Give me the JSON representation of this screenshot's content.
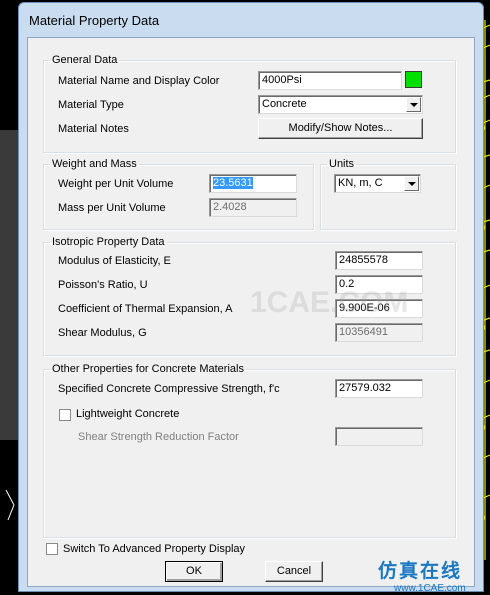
{
  "dialog": {
    "title": "Material Property Data"
  },
  "general": {
    "legend": "General Data",
    "name_label": "Material Name and Display Color",
    "name_value": "4000Psi",
    "display_color": "#00e000",
    "type_label": "Material Type",
    "type_value": "Concrete",
    "notes_label": "Material Notes",
    "notes_button": "Modify/Show Notes..."
  },
  "weight": {
    "legend": "Weight and Mass",
    "weight_label": "Weight per Unit Volume",
    "weight_value": "23.5631",
    "mass_label": "Mass per Unit Volume",
    "mass_value": "2.4028"
  },
  "units": {
    "legend": "Units",
    "value": "KN, m, C"
  },
  "isotropic": {
    "legend": "Isotropic Property Data",
    "modulus_label": "Modulus of Elasticity,  E",
    "modulus_value": "24855578",
    "poisson_label": "Poisson's Ratio,  U",
    "poisson_value": "0.2",
    "thermal_label": "Coefficient of Thermal Expansion,  A",
    "thermal_value": "9.900E-06",
    "shear_label": "Shear Modulus,  G",
    "shear_value": "10356491"
  },
  "concrete": {
    "legend": "Other Properties for Concrete Materials",
    "fc_label": "Specified Concrete Compressive Strength, f'c",
    "fc_value": "27579.032",
    "lightweight_label": "Lightweight Concrete",
    "srf_label": "Shear Strength Reduction Factor",
    "srf_value": ""
  },
  "footer": {
    "advanced_label": "Switch To Advanced Property Display",
    "ok_label": "OK",
    "cancel_label": "Cancel"
  },
  "watermark": {
    "cn_text": "仿真在线",
    "url_text": "www.1CAE.com",
    "center_text": "1CAE.COM"
  }
}
